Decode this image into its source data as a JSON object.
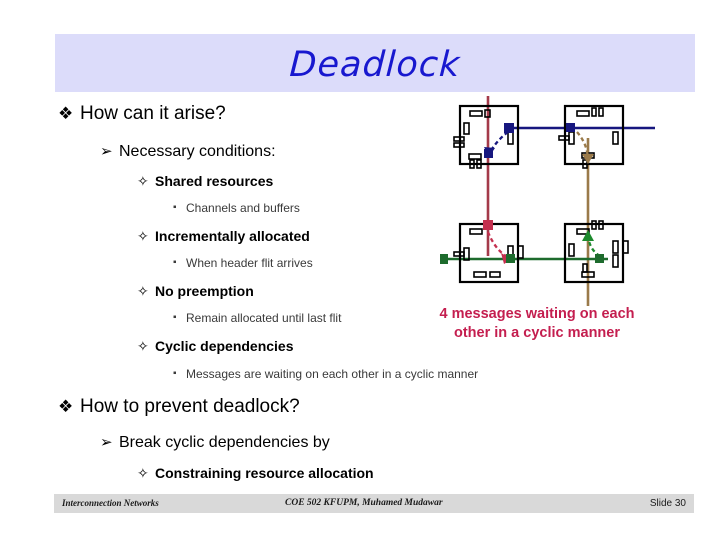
{
  "slide": {
    "title": "Deadlock",
    "title_color": "#1818cf",
    "banner_color": "#dcdcfa"
  },
  "outline": [
    {
      "level": 1,
      "marker": "❖",
      "text": "How can it arise?"
    },
    {
      "level": 2,
      "marker": "➢",
      "text": "Necessary conditions:"
    },
    {
      "level": 3,
      "marker": "✧",
      "text": "Shared resources"
    },
    {
      "level": 4,
      "marker": "▪",
      "text": "Channels and buffers"
    },
    {
      "level": 3,
      "marker": "✧",
      "text": "Incrementally allocated"
    },
    {
      "level": 4,
      "marker": "▪",
      "text": "When header flit arrives"
    },
    {
      "level": 3,
      "marker": "✧",
      "text": "No preemption"
    },
    {
      "level": 4,
      "marker": "▪",
      "text": "Remain allocated until last flit"
    },
    {
      "level": 3,
      "marker": "✧",
      "text": "Cyclic dependencies"
    },
    {
      "level": 4,
      "marker": "▪",
      "text": "Messages are waiting on each other in a cyclic manner"
    },
    {
      "level": 1,
      "marker": "❖",
      "text": "How to prevent deadlock?"
    },
    {
      "level": 2,
      "marker": "➢",
      "text": "Break cyclic dependencies by"
    },
    {
      "level": 3,
      "marker": "✧",
      "text": "Constraining resource allocation"
    }
  ],
  "callout": {
    "line1": "4 messages waiting on each",
    "line2": "other in a cyclic manner",
    "color": "#c41e4f"
  },
  "diagram": {
    "description": "2x2 mesh of routers with four messages forming a cyclic dependency",
    "router_count": 4,
    "message_count": 4,
    "links": [
      {
        "name": "north-south-left",
        "color": "#a43a4a",
        "orientation": "vertical"
      },
      {
        "name": "east-west-top",
        "color": "#17177f",
        "orientation": "horizontal"
      },
      {
        "name": "north-south-right",
        "color": "#9a7a4a",
        "orientation": "vertical"
      },
      {
        "name": "east-west-bottom",
        "color": "#1d6b2d",
        "orientation": "horizontal"
      }
    ],
    "messages": [
      {
        "name": "blue-message",
        "color": "#17177f",
        "turn": "east-to-south"
      },
      {
        "name": "brown-message",
        "color": "#9a7a4a",
        "turn": "west-to-south"
      },
      {
        "name": "crimson-message",
        "color": "#c4304f",
        "turn": "north-to-east"
      },
      {
        "name": "green-message",
        "color": "#1d8a2d",
        "turn": "west-to-north"
      }
    ]
  },
  "footer": {
    "left": "Interconnection Networks",
    "center": "COE 502 KFUPM, Muhamed Mudawar",
    "right": "Slide 30"
  }
}
